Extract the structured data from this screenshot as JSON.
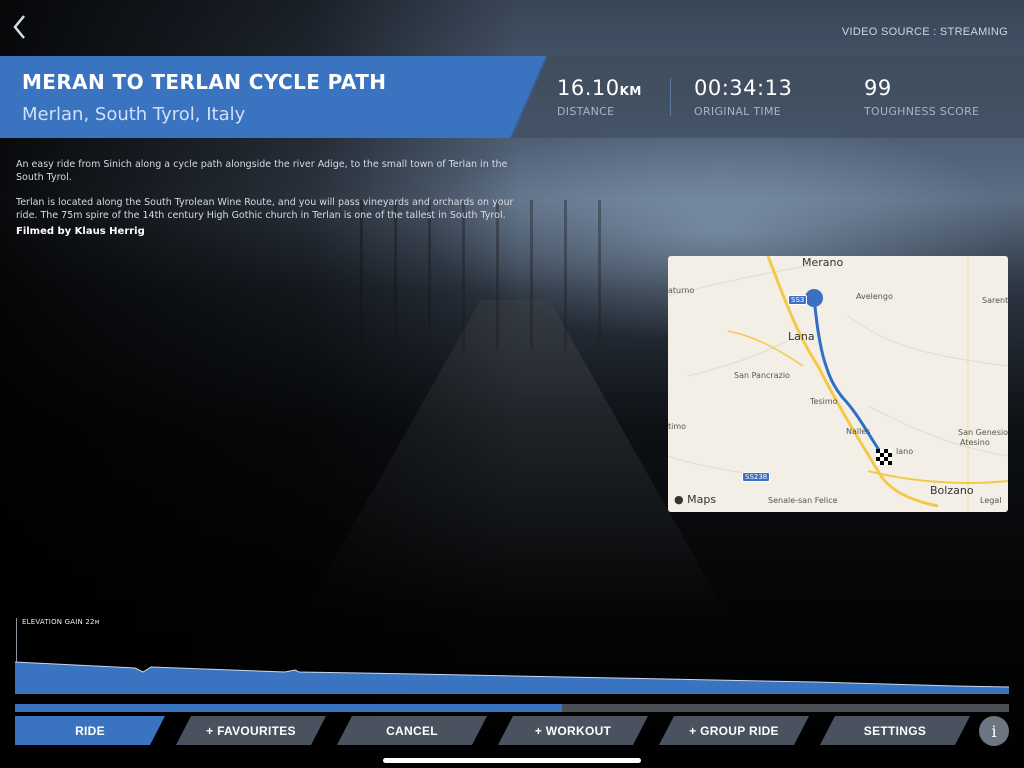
{
  "header": {
    "back_icon": "chevron-left-icon",
    "video_source": "VIDEO SOURCE : STREAMING"
  },
  "route": {
    "name": "MERAN TO TERLAN CYCLE PATH",
    "location": "Merlan, South Tyrol, Italy"
  },
  "stats": [
    {
      "value": "16.10",
      "unit": "KM",
      "label": "DISTANCE"
    },
    {
      "value": "00:34:13",
      "unit": "",
      "label": "ORIGINAL TIME"
    },
    {
      "value": "99",
      "unit": "",
      "label": "TOUGHNESS SCORE"
    }
  ],
  "description": {
    "paragraph1": "An easy ride from Sinich along a cycle path alongside the river Adige, to the small town of Terlan in the South Tyrol.",
    "paragraph2": "Terlan is located along the South Tyrolean Wine Route, and you will pass vineyards and orchards on your ride.  The 75m spire of the 14th century High Gothic church in Terlan is one of the tallest in South Tyrol.",
    "filmed_by": "Filmed by Klaus Herrig"
  },
  "map": {
    "attribution": "Maps",
    "labels": {
      "merano": "Merano",
      "lana": "Lana",
      "avelengo": "Avelengo",
      "san_pancrazio": "San Pancrazio",
      "tesimo": "Tesimo",
      "nalles": "Nalles",
      "terlano": "lano",
      "san_genesio": "San Genesio",
      "atesino": "Atesino",
      "bolzano": "Bolzano",
      "senale": "Senale-san Felice",
      "sarentino": "Sarent",
      "naturno": "aturno",
      "timo": "timo",
      "leifers": "Legal"
    },
    "shields": {
      "ss38": "SS3",
      "ss238": "SS238"
    },
    "colors": {
      "route": "#2f6fc4",
      "roads": "#f3c94a",
      "start": "#3b6fc4"
    }
  },
  "elevation": {
    "label": "ELEVATION GAIN 22",
    "unit": "M",
    "fill_color": "#3a73bf"
  },
  "progress": {
    "fraction": 0.55
  },
  "tabs": [
    {
      "label": "RIDE",
      "active": true
    },
    {
      "label": "+ FAVOURITES",
      "active": false
    },
    {
      "label": "CANCEL",
      "active": false
    },
    {
      "label": "+ WORKOUT",
      "active": false
    },
    {
      "label": "+ GROUP RIDE",
      "active": false
    },
    {
      "label": "SETTINGS",
      "active": false
    }
  ],
  "info_label": "i",
  "colors": {
    "accent": "#3a73bf"
  }
}
